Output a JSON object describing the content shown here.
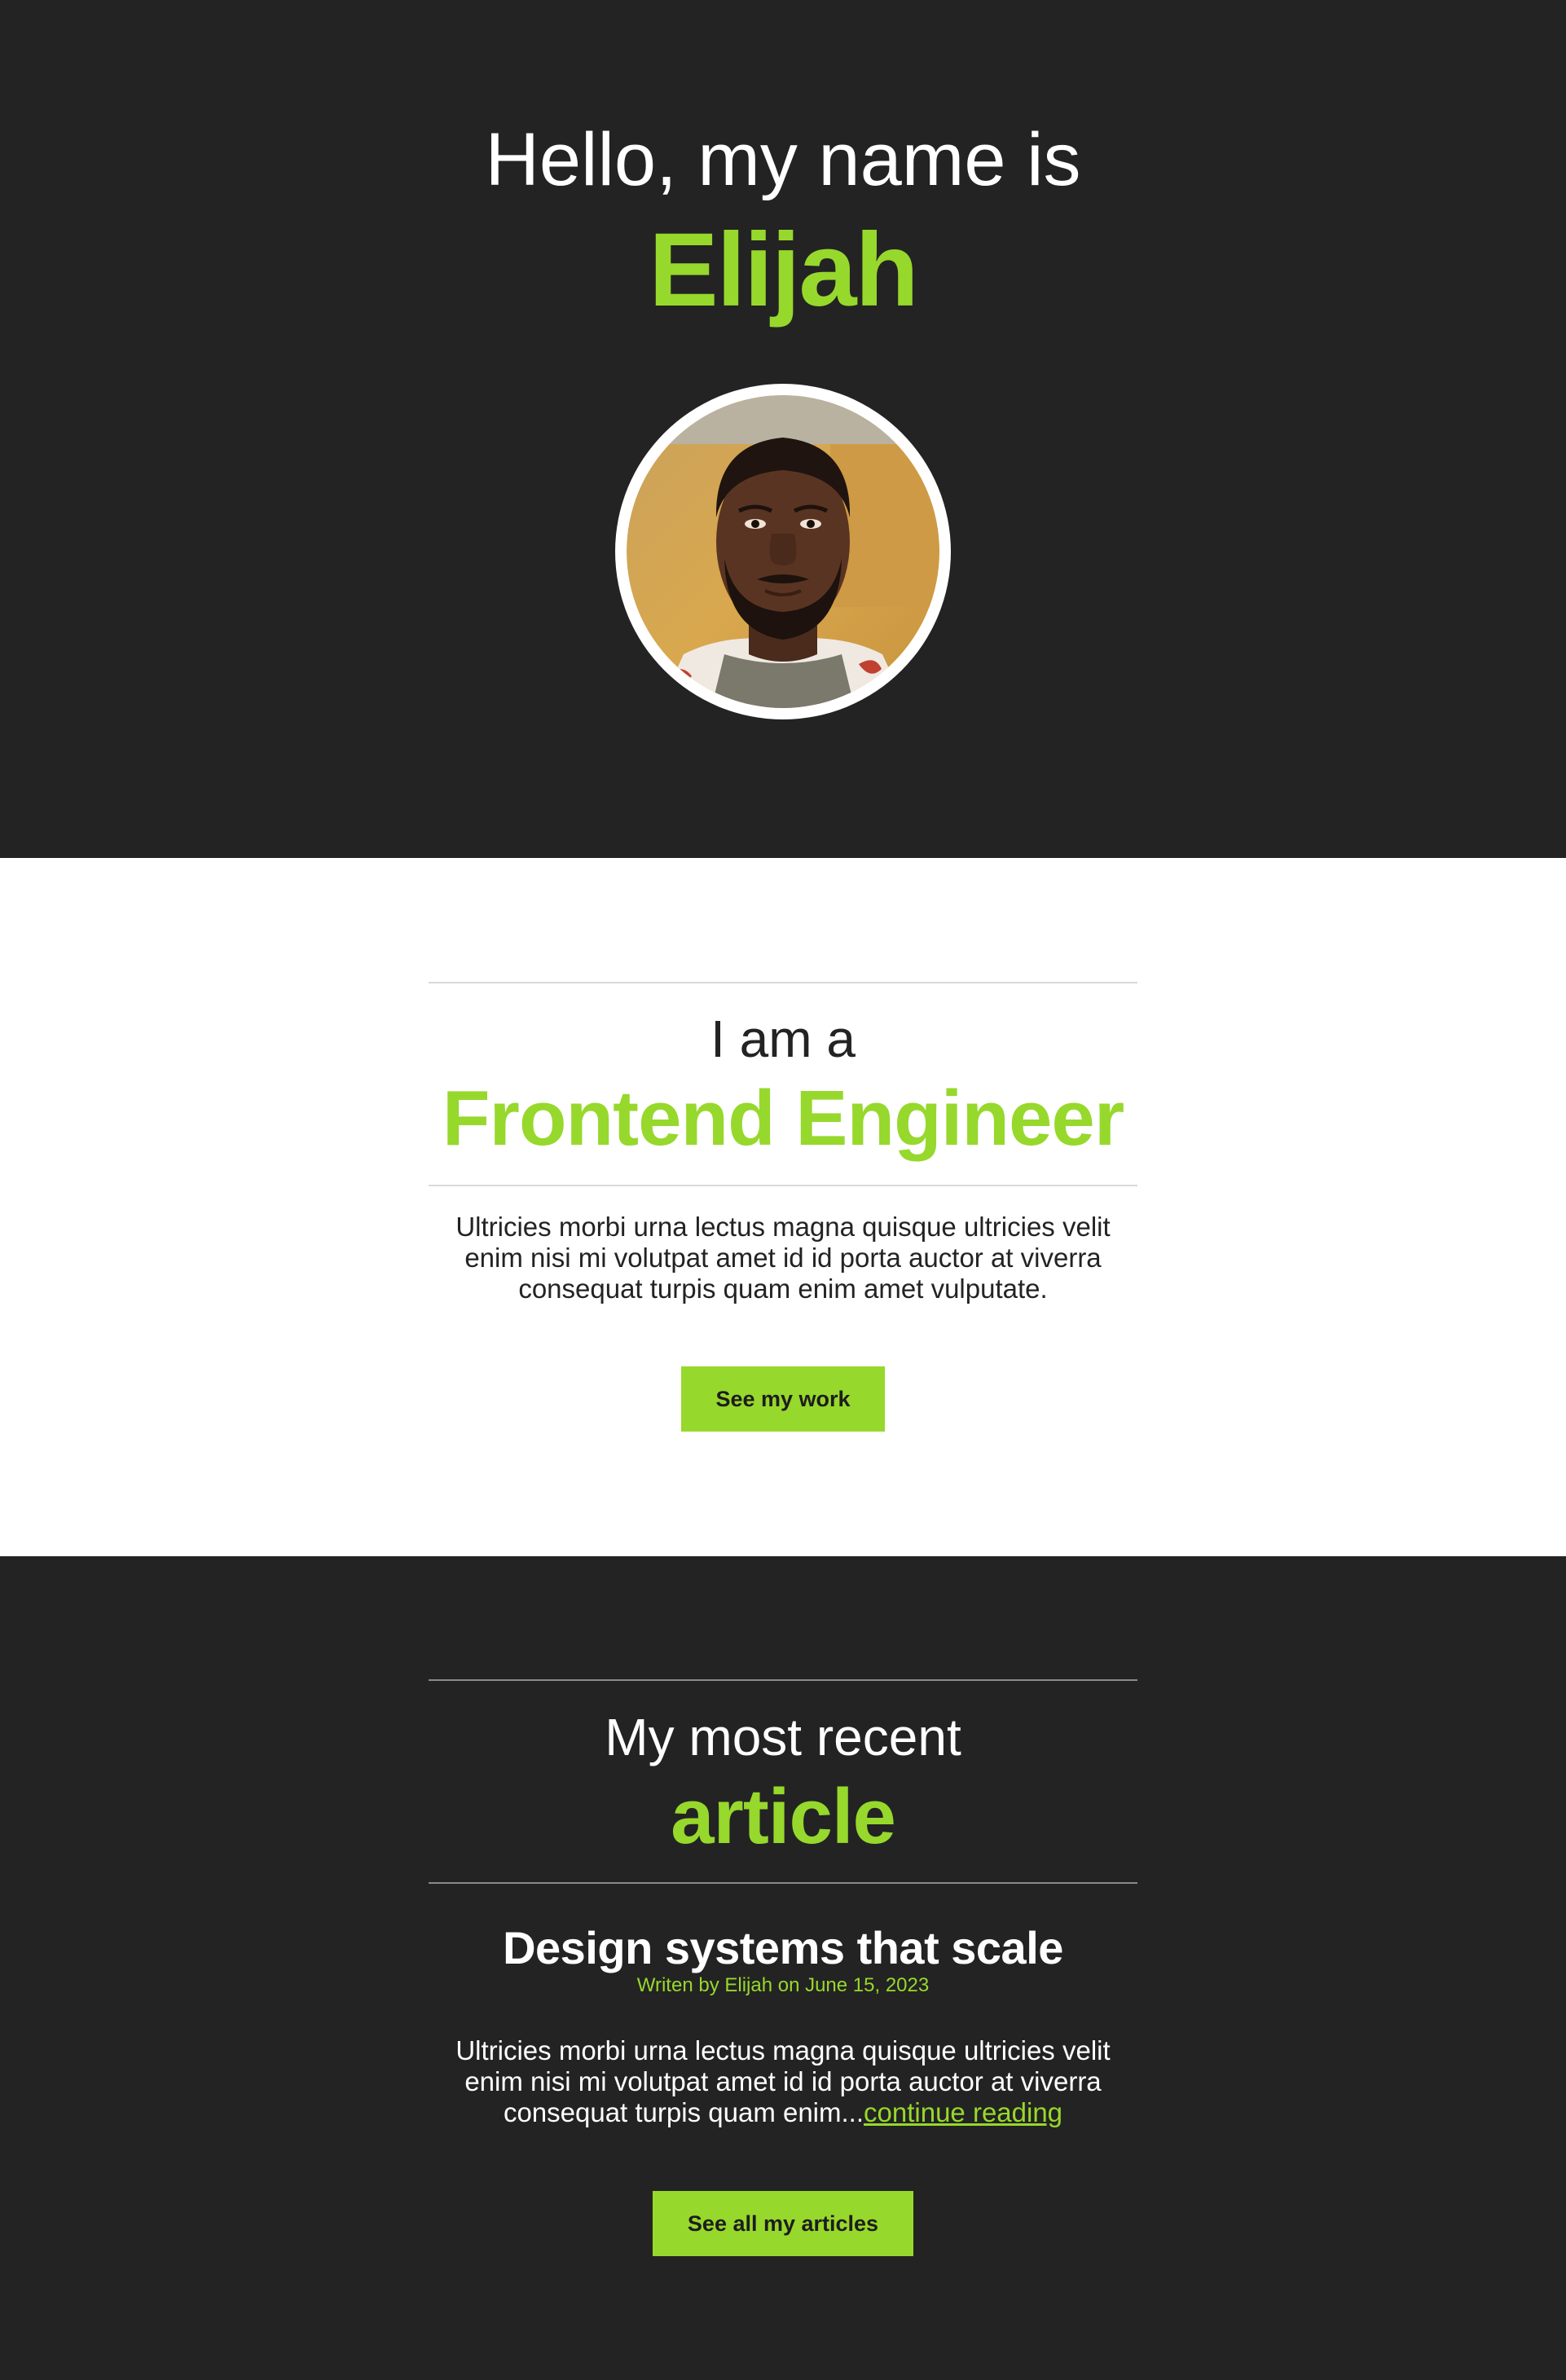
{
  "hero": {
    "intro": "Hello, my name is",
    "name": "Elijah",
    "avatar_alt": "Elijah"
  },
  "about": {
    "kicker": "I am a",
    "role": "Frontend Engineer",
    "description": "Ultricies morbi urna lectus magna quisque ultricies velit enim nisi mi volutpat amet id id porta auctor at viverra consequat turpis quam enim amet vulputate.",
    "cta_label": "See my work"
  },
  "article": {
    "kicker": "My most recent",
    "heading": "article",
    "title": "Design systems that scale",
    "meta": "Writen by Elijah on June 15, 2023",
    "excerpt": "Ultricies morbi urna lectus magna quisque ultricies velit enim nisi mi volutpat amet id id porta auctor at viverra consequat turpis quam enim...",
    "continue_label": "continue reading",
    "cta_label": "See all my articles"
  },
  "colors": {
    "accent": "#97d82c",
    "dark_bg": "#232323",
    "light_bg": "#ffffff"
  }
}
